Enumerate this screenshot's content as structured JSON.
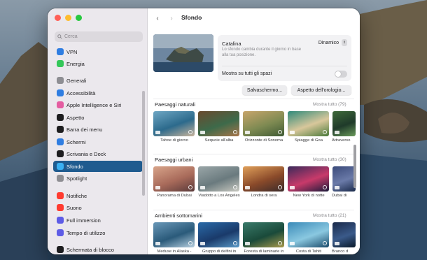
{
  "sidebar": {
    "search_placeholder": "Cerca",
    "items": [
      {
        "label": "VPN",
        "icon": "vpn-icon",
        "color": "#2f7de1"
      },
      {
        "label": "Energia",
        "icon": "battery-icon",
        "color": "#34c759"
      },
      {
        "label": "Generali",
        "icon": "gear-icon",
        "color": "#8e8e93"
      },
      {
        "label": "Accessibilità",
        "icon": "accessibility-icon",
        "color": "#2f7de1"
      },
      {
        "label": "Apple Intelligence e Siri",
        "icon": "siri-icon",
        "color": "#e45da1"
      },
      {
        "label": "Aspetto",
        "icon": "appearance-icon",
        "color": "#1d1d1f"
      },
      {
        "label": "Barra dei menu",
        "icon": "menubar-icon",
        "color": "#1d1d1f"
      },
      {
        "label": "Schermi",
        "icon": "display-icon",
        "color": "#2f7de1"
      },
      {
        "label": "Scrivania e Dock",
        "icon": "dock-icon",
        "color": "#1d1d1f"
      },
      {
        "label": "Sfondo",
        "icon": "wallpaper-icon",
        "color": "#3ab0f2"
      },
      {
        "label": "Spotlight",
        "icon": "spotlight-icon",
        "color": "#8e8e93"
      },
      {
        "label": "Notifiche",
        "icon": "bell-icon",
        "color": "#ff3b30"
      },
      {
        "label": "Suono",
        "icon": "speaker-icon",
        "color": "#ff3b30"
      },
      {
        "label": "Full immersion",
        "icon": "moon-icon",
        "color": "#5e5ce6"
      },
      {
        "label": "Tempo di utilizzo",
        "icon": "hourglass-icon",
        "color": "#5e5ce6"
      },
      {
        "label": "Schermata di blocco",
        "icon": "lock-icon",
        "color": "#1d1d1f"
      }
    ],
    "active_index": 9
  },
  "toolbar": {
    "title": "Sfondo"
  },
  "current": {
    "name": "Catalina",
    "description": "Lo sfondo cambia durante il giorno in base alla tua posizione.",
    "mode": "Dinamico",
    "spaces_label": "Mostra su tutti gli spazi",
    "spaces_enabled": false
  },
  "buttons": {
    "screensaver": "Salvaschermo...",
    "clock": "Aspetto dell'orologio..."
  },
  "sections": [
    {
      "title": "Paesaggi naturali",
      "more": "Mostra tutto (79)",
      "items": [
        {
          "label": "Tahoe di giorno",
          "colors": [
            "#6fa7c4",
            "#2c6a8c",
            "#c9b49b"
          ]
        },
        {
          "label": "Sequoie all'alba",
          "colors": [
            "#6a4a2e",
            "#3d6a4a",
            "#a8754a"
          ]
        },
        {
          "label": "Orizzonte di Sonoma",
          "colors": [
            "#c8a56b",
            "#7e8a52",
            "#3f5a34"
          ]
        },
        {
          "label": "Spiagge di Goa",
          "colors": [
            "#2f8a7a",
            "#d8c79b",
            "#4a7a3a"
          ]
        },
        {
          "label": "Attraverso",
          "colors": [
            "#3f6a3a",
            "#1f3a2a",
            "#6a9a5a"
          ]
        }
      ]
    },
    {
      "title": "Paesaggi urbani",
      "more": "Mostra tutto (30)",
      "items": [
        {
          "label": "Panorama di Dubai",
          "colors": [
            "#d8a48a",
            "#a86a5a",
            "#5a3a3a"
          ]
        },
        {
          "label": "Viadotto a Los Angeles",
          "colors": [
            "#9aa6a8",
            "#6a7a7e",
            "#c8c8c0"
          ]
        },
        {
          "label": "Londra di sera",
          "colors": [
            "#e0a05a",
            "#8a4a2a",
            "#3a2a2a"
          ]
        },
        {
          "label": "New York di notte",
          "colors": [
            "#3a2a5a",
            "#c83a6a",
            "#1a1a3a"
          ]
        },
        {
          "label": "Dubai di",
          "colors": [
            "#3a4a7a",
            "#6a7aa8",
            "#1a2a4a"
          ]
        }
      ]
    },
    {
      "title": "Ambienti sottomarini",
      "more": "Mostra tutto (21)",
      "items": [
        {
          "label": "Meduse in Alaska - Chiaro",
          "colors": [
            "#6a98b8",
            "#2a5a7a",
            "#b8d0e0"
          ]
        },
        {
          "label": "Gruppo di delfini in California",
          "colors": [
            "#2a6aa8",
            "#1a3a6a",
            "#5a9ac8"
          ]
        },
        {
          "label": "Foresta di laminarie in California",
          "colors": [
            "#3a7a6a",
            "#1a4a3a",
            "#a89a4a"
          ]
        },
        {
          "label": "Costa di Tahiti",
          "colors": [
            "#3a8ab8",
            "#8ac8e0",
            "#1a4a6a"
          ]
        },
        {
          "label": "Branco d",
          "colors": [
            "#1a2a4a",
            "#3a5a8a",
            "#0a1a2a"
          ]
        }
      ]
    }
  ]
}
